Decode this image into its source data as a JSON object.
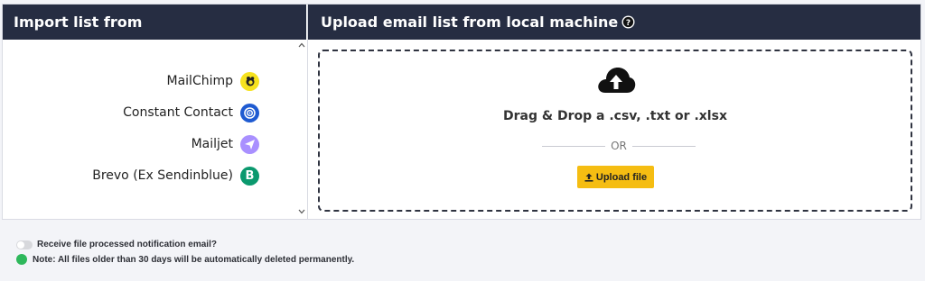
{
  "import_panel": {
    "title": "Import list from",
    "services": [
      {
        "label": "MailChimp",
        "icon": "mailchimp-logo-icon",
        "color": "#f6e21e"
      },
      {
        "label": "Constant Contact",
        "icon": "constant-contact-logo-icon",
        "color": "#1f5bd1"
      },
      {
        "label": "Mailjet",
        "icon": "mailjet-logo-icon",
        "color": "#a990ff"
      },
      {
        "label": "Brevo (Ex Sendinblue)",
        "icon": "brevo-logo-icon",
        "color": "#0b996e"
      }
    ]
  },
  "upload_panel": {
    "title": "Upload email list from local machine",
    "dropzone_text": "Drag & Drop a .csv, .txt or .xlsx",
    "or_text": "OR",
    "upload_button": "Upload file"
  },
  "notification": {
    "label": "Receive file processed notification email?",
    "enabled": false
  },
  "note": {
    "text": "Note: All files older than 30 days will be automatically deleted permanently.",
    "color": "#2eb85c"
  },
  "colors": {
    "header_bg": "#262d42",
    "accent": "#f5bd12"
  }
}
